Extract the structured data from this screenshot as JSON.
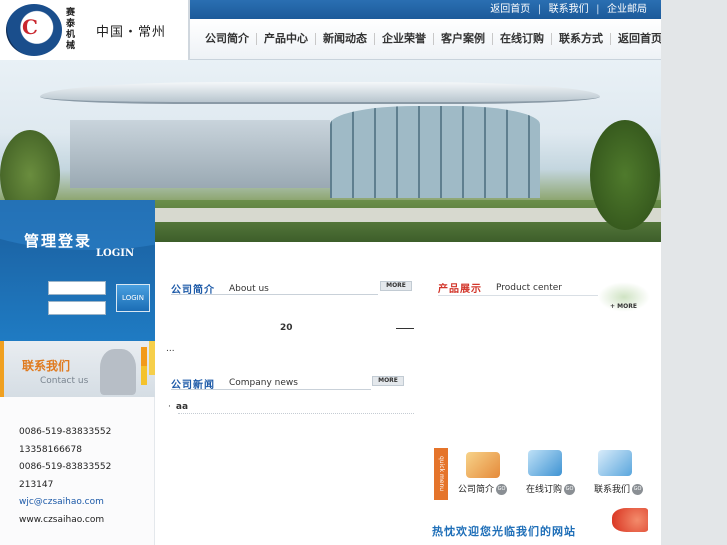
{
  "brand": {
    "vertical_name": "赛泰机械",
    "city": "中国・常州"
  },
  "topbar": {
    "links": [
      "返回首页",
      "联系我们",
      "企业邮局"
    ],
    "separator": "|"
  },
  "nav": {
    "items": [
      "公司简介",
      "产品中心",
      "新闻动态",
      "企业荣誉",
      "客户案例",
      "在线订购",
      "联系方式",
      "返回首页"
    ]
  },
  "login": {
    "title": "管理登录",
    "subtitle": "LOGIN",
    "button": "LOGIN"
  },
  "contact": {
    "title": "联系我们",
    "subtitle": "Contact us",
    "lines": [
      "0086-519-83833552",
      "13358166678",
      "0086-519-83833552",
      "213147",
      "wjc@czsaihao.com",
      "www.czsaihao.com"
    ]
  },
  "about": {
    "title": "公司简介",
    "subtitle": "About us",
    "more": "MORE",
    "snippet_number": "20",
    "snippet_tail": "..."
  },
  "news": {
    "title": "公司新闻",
    "subtitle": "Company news",
    "more": "MORE",
    "items": [
      "aa"
    ]
  },
  "products": {
    "title": "产品展示",
    "subtitle": "Product center",
    "more": "MORE"
  },
  "quick": {
    "tag": "quick menu",
    "items": [
      "公司简介",
      "在线订购",
      "联系我们"
    ],
    "go": "GO"
  },
  "footer": {
    "welcome": "热忱欢迎您光临我们的网站"
  },
  "colors": {
    "primary_blue": "#1c5a9a",
    "accent_orange": "#e07a1e",
    "accent_red": "#d2352a"
  }
}
